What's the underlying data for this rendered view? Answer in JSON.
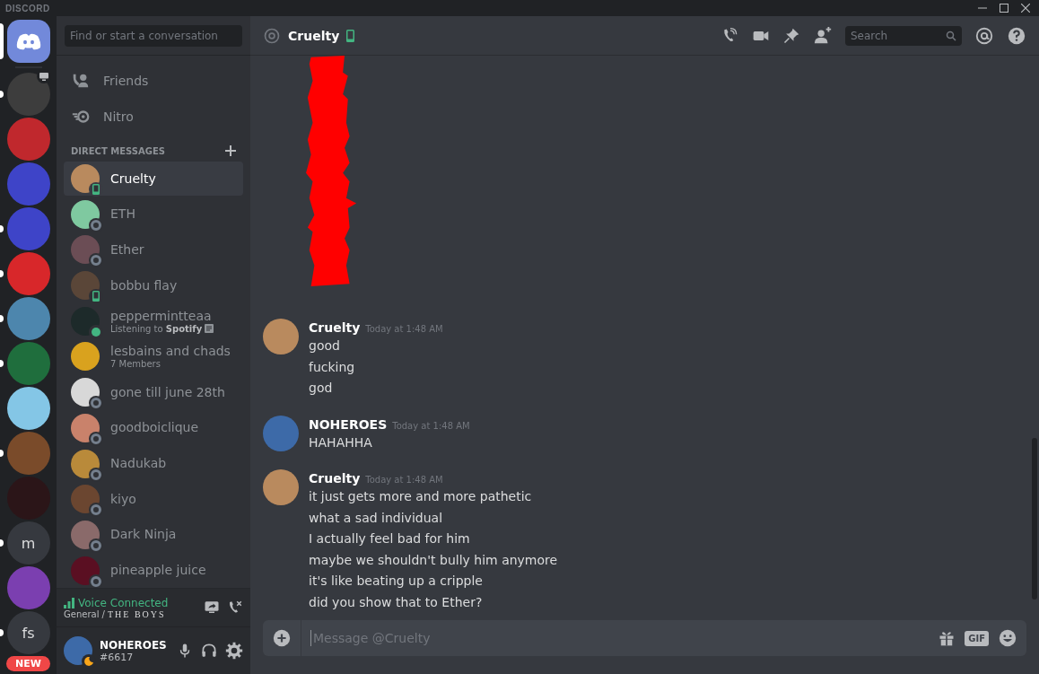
{
  "window": {
    "brand": "DISCORD"
  },
  "servers": {
    "items": [
      {
        "kind": "home",
        "selected": true
      },
      {
        "kind": "image",
        "color": "#3d3d3d",
        "selected": false,
        "unread": true,
        "badge": {
          "kind": "screen"
        }
      },
      {
        "kind": "image",
        "color": "#c0282d",
        "selected": false,
        "unread": false
      },
      {
        "kind": "image",
        "color": "#3e44c8",
        "selected": false,
        "unread": false
      },
      {
        "kind": "image",
        "color": "#3e44c8",
        "selected": false,
        "unread": true
      },
      {
        "kind": "image",
        "color": "#d8272a",
        "selected": false,
        "unread": true
      },
      {
        "kind": "image",
        "color": "#4d86ad",
        "selected": false,
        "unread": true
      },
      {
        "kind": "image",
        "color": "#1f6e3d",
        "selected": false,
        "unread": true
      },
      {
        "kind": "image",
        "color": "#84c6e6",
        "selected": false,
        "unread": false
      },
      {
        "kind": "image",
        "color": "#7a4b2a",
        "selected": false,
        "unread": true
      },
      {
        "kind": "image",
        "color": "#2b1518",
        "selected": false,
        "unread": false
      },
      {
        "kind": "text",
        "label": "m",
        "selected": false,
        "unread": true
      },
      {
        "kind": "image",
        "color": "#7b3fb0",
        "selected": false,
        "unread": false
      },
      {
        "kind": "text",
        "label": "fs",
        "selected": false,
        "unread": true
      }
    ],
    "new_badge": "NEW"
  },
  "dm_sidebar": {
    "search": {
      "placeholder": "Find or start a conversation"
    },
    "nav": [
      {
        "kind": "friends",
        "label": "Friends"
      },
      {
        "kind": "nitro",
        "label": "Nitro"
      }
    ],
    "section": "DIRECT MESSAGES",
    "dms": [
      {
        "name": "Cruelty",
        "color": "#b98a5e",
        "status": {
          "kind": "mobile"
        },
        "selected": true
      },
      {
        "name": "ETH",
        "color": "#7fc9a0",
        "status": {
          "kind": "offline"
        },
        "selected": false
      },
      {
        "name": "Ether",
        "color": "#6b4d55",
        "status": {
          "kind": "offline"
        },
        "selected": false
      },
      {
        "name": "bobbu flay",
        "color": "#5a4638",
        "status": {
          "kind": "mobile"
        },
        "selected": false
      },
      {
        "name": "peppermintteaa",
        "color": "#1d2a2a",
        "status": {
          "kind": "online"
        },
        "subtitle": "Listening to **Spotify**",
        "selected": false
      },
      {
        "name": "lesbains and chads",
        "color": "#d9a21e",
        "subtitle": "7 Members",
        "selected": false
      },
      {
        "name": "gone till june 28th",
        "color": "#d8d8d8",
        "status": {
          "kind": "offline"
        },
        "selected": false
      },
      {
        "name": "goodboiclique",
        "color": "#c9826b",
        "status": {
          "kind": "offline"
        },
        "selected": false
      },
      {
        "name": "Nadukab",
        "color": "#b98a3a",
        "status": {
          "kind": "offline"
        },
        "selected": false
      },
      {
        "name": "kiyo",
        "color": "#6b4630",
        "status": {
          "kind": "offline"
        },
        "selected": false
      },
      {
        "name": "Dark Ninja",
        "color": "#8a6a6a",
        "status": {
          "kind": "offline"
        },
        "selected": false
      },
      {
        "name": "pineapple juice",
        "color": "#5a0f22",
        "status": {
          "kind": "offline"
        },
        "selected": false
      }
    ],
    "voice": {
      "title": "Voice Connected",
      "location": "General /",
      "server": "THE BOYS"
    },
    "user": {
      "name": "NOHEROES",
      "tag": "#6617",
      "color": "#3d6aa8",
      "status": {
        "kind": "idle"
      }
    }
  },
  "chat": {
    "header": {
      "name": "Cruelty",
      "status": {
        "kind": "mobile"
      },
      "search_placeholder": "Search"
    },
    "messages": [
      {
        "kind": "redacted"
      },
      {
        "kind": "group",
        "author": "Cruelty",
        "time": "Today at 1:48 AM",
        "color": "#b98a5e",
        "lines": [
          "good",
          "fucking",
          "god"
        ]
      },
      {
        "kind": "group",
        "author": "NOHEROES",
        "time": "Today at 1:48 AM",
        "color": "#3d6aa8",
        "lines": [
          "HAHAHHA"
        ]
      },
      {
        "kind": "group",
        "author": "Cruelty",
        "time": "Today at 1:48 AM",
        "color": "#b98a5e",
        "lines": [
          "it just gets more and more pathetic",
          "what a sad individual",
          "I actually feel bad for him",
          "maybe we shouldn't bully him anymore",
          "it's like beating up a cripple",
          "did you show that to Ether?"
        ]
      }
    ],
    "composer": {
      "placeholder": "Message @Cruelty",
      "gif_label": "GIF"
    }
  }
}
